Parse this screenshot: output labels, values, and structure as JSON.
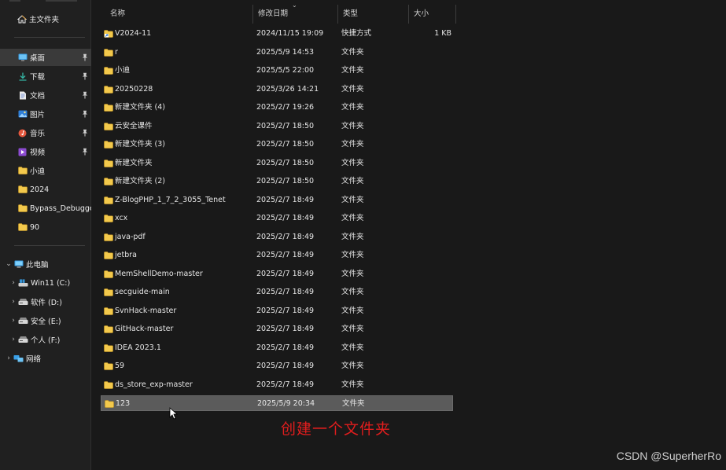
{
  "sidebar": {
    "home": {
      "label": "主文件夹",
      "icon": "home-icon"
    },
    "quick_access": [
      {
        "label": "桌面",
        "icon": "desktop-icon",
        "pinned": true,
        "selected": true
      },
      {
        "label": "下载",
        "icon": "download-icon",
        "pinned": true
      },
      {
        "label": "文档",
        "icon": "document-icon",
        "pinned": true
      },
      {
        "label": "图片",
        "icon": "picture-icon",
        "pinned": true
      },
      {
        "label": "音乐",
        "icon": "music-icon",
        "pinned": true
      },
      {
        "label": "视频",
        "icon": "video-icon",
        "pinned": true
      },
      {
        "label": "小迪",
        "icon": "folder-icon"
      },
      {
        "label": "2024",
        "icon": "folder-icon"
      },
      {
        "label": "Bypass_Debugger",
        "icon": "folder-icon"
      },
      {
        "label": "90",
        "icon": "folder-icon"
      }
    ],
    "this_pc": {
      "label": "此电脑",
      "icon": "computer-icon",
      "expanded": true
    },
    "drives": [
      {
        "label": "Win11 (C:)",
        "icon": "windows-drive-icon"
      },
      {
        "label": "软件 (D:)",
        "icon": "drive-icon"
      },
      {
        "label": "安全 (E:)",
        "icon": "drive-icon"
      },
      {
        "label": "个人 (F:)",
        "icon": "drive-icon"
      }
    ],
    "network": {
      "label": "网络",
      "icon": "network-icon"
    }
  },
  "columns": {
    "name": "名称",
    "date": "修改日期",
    "type": "类型",
    "size": "大小"
  },
  "files": [
    {
      "name": "V2024-11",
      "date": "2024/11/15 19:09",
      "type": "快捷方式",
      "size": "1 KB",
      "icon": "shortcut-folder-icon"
    },
    {
      "name": "r",
      "date": "2025/5/9 14:53",
      "type": "文件夹",
      "size": ""
    },
    {
      "name": "小迪",
      "date": "2025/5/5 22:00",
      "type": "文件夹",
      "size": ""
    },
    {
      "name": "20250228",
      "date": "2025/3/26 14:21",
      "type": "文件夹",
      "size": ""
    },
    {
      "name": "新建文件夹 (4)",
      "date": "2025/2/7 19:26",
      "type": "文件夹",
      "size": ""
    },
    {
      "name": "云安全课件",
      "date": "2025/2/7 18:50",
      "type": "文件夹",
      "size": ""
    },
    {
      "name": "新建文件夹 (3)",
      "date": "2025/2/7 18:50",
      "type": "文件夹",
      "size": ""
    },
    {
      "name": "新建文件夹",
      "date": "2025/2/7 18:50",
      "type": "文件夹",
      "size": ""
    },
    {
      "name": "新建文件夹 (2)",
      "date": "2025/2/7 18:50",
      "type": "文件夹",
      "size": ""
    },
    {
      "name": "Z-BlogPHP_1_7_2_3055_Tenet",
      "date": "2025/2/7 18:49",
      "type": "文件夹",
      "size": ""
    },
    {
      "name": "xcx",
      "date": "2025/2/7 18:49",
      "type": "文件夹",
      "size": ""
    },
    {
      "name": "java-pdf",
      "date": "2025/2/7 18:49",
      "type": "文件夹",
      "size": ""
    },
    {
      "name": "jetbra",
      "date": "2025/2/7 18:49",
      "type": "文件夹",
      "size": ""
    },
    {
      "name": "MemShellDemo-master",
      "date": "2025/2/7 18:49",
      "type": "文件夹",
      "size": ""
    },
    {
      "name": "secguide-main",
      "date": "2025/2/7 18:49",
      "type": "文件夹",
      "size": ""
    },
    {
      "name": "SvnHack-master",
      "date": "2025/2/7 18:49",
      "type": "文件夹",
      "size": ""
    },
    {
      "name": "GitHack-master",
      "date": "2025/2/7 18:49",
      "type": "文件夹",
      "size": ""
    },
    {
      "name": "IDEA 2023.1",
      "date": "2025/2/7 18:49",
      "type": "文件夹",
      "size": ""
    },
    {
      "name": "59",
      "date": "2025/2/7 18:49",
      "type": "文件夹",
      "size": ""
    },
    {
      "name": "ds_store_exp-master",
      "date": "2025/2/7 18:49",
      "type": "文件夹",
      "size": ""
    },
    {
      "name": "123",
      "date": "2025/5/9 20:34",
      "type": "文件夹",
      "size": "",
      "selected": true
    }
  ],
  "annotation": "创建一个文件夹",
  "watermark": "CSDN @SuperherRo",
  "colors": {
    "folder": "#f3c94c",
    "annotation": "#e11d1d",
    "selection": "#5b5b5b"
  }
}
